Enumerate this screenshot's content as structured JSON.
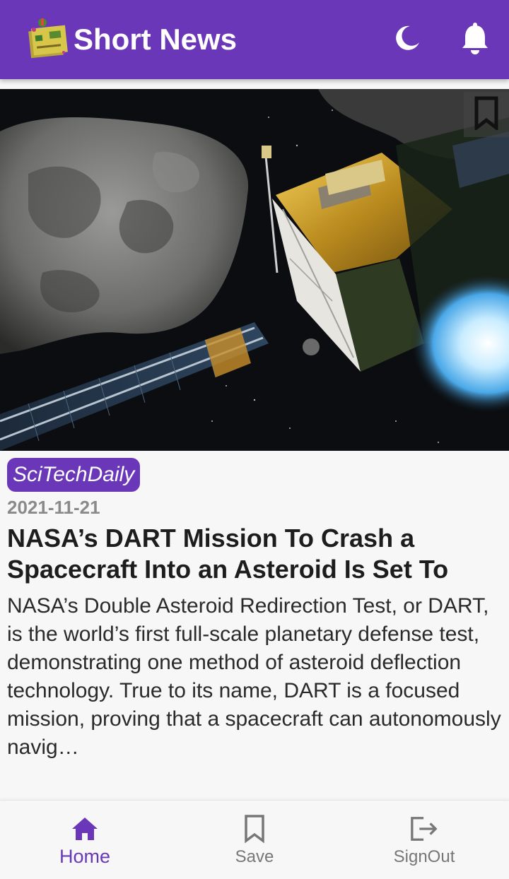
{
  "app": {
    "title": "Short News",
    "accent_color": "#6a37b8"
  },
  "header": {
    "icons": [
      "app-logo-icon",
      "moon-icon",
      "bell-icon"
    ]
  },
  "article": {
    "image": "dart-spacecraft-asteroid",
    "bookmark_icon": "bookmark-icon",
    "source": "SciTechDaily",
    "date": "2021-11-21",
    "title": "NASA’s DART Mission To Crash a Spacecraft Into an Asteroid Is Set To",
    "summary": "NASA’s Double Asteroid Redirection Test, or DART, is the world’s first full-scale planetary defense test, demonstrating one method of asteroid deflection technology. True to its name, DART is a focused mission, proving that a spacecraft can autonomously navig…"
  },
  "bottom_nav": {
    "items": [
      {
        "label": "Home",
        "icon": "home-icon",
        "active": true
      },
      {
        "label": "Save",
        "icon": "bookmark-outline-icon",
        "active": false
      },
      {
        "label": "SignOut",
        "icon": "signout-icon",
        "active": false
      }
    ]
  }
}
